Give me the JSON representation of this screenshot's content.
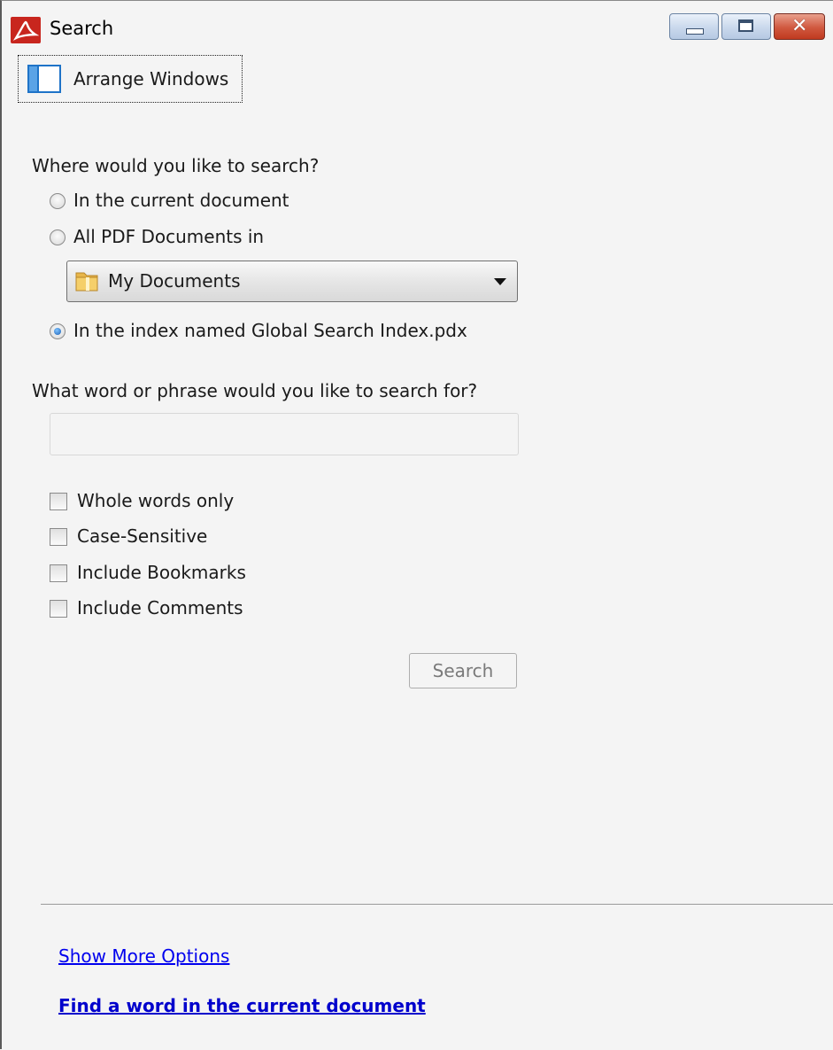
{
  "window": {
    "title": "Search",
    "controls": [
      "minimize-icon",
      "maximize-icon",
      "close-icon"
    ],
    "close_glyph": "✕"
  },
  "toolbar": {
    "arrange_label": "Arrange Windows"
  },
  "where": {
    "question": "Where would you like to search?",
    "options": [
      {
        "label": "In the current document",
        "checked": false
      },
      {
        "label": "All PDF Documents in",
        "checked": false
      },
      {
        "label": "In the index named Global Search Index.pdx",
        "checked": true
      }
    ],
    "folder": "My Documents"
  },
  "what": {
    "question": "What word or phrase would you like to search for?",
    "value": "",
    "placeholder": ""
  },
  "options": [
    {
      "label": "Whole words only",
      "checked": false
    },
    {
      "label": "Case-Sensitive",
      "checked": false
    },
    {
      "label": "Include Bookmarks",
      "checked": false
    },
    {
      "label": "Include Comments",
      "checked": false
    }
  ],
  "search_button": "Search",
  "links": {
    "more_options": "Show More Options",
    "find_word": "Find a word in the current document"
  },
  "colors": {
    "accent": "#1a5fb4",
    "link": "#0000ee",
    "app_icon": "#c8261e"
  }
}
